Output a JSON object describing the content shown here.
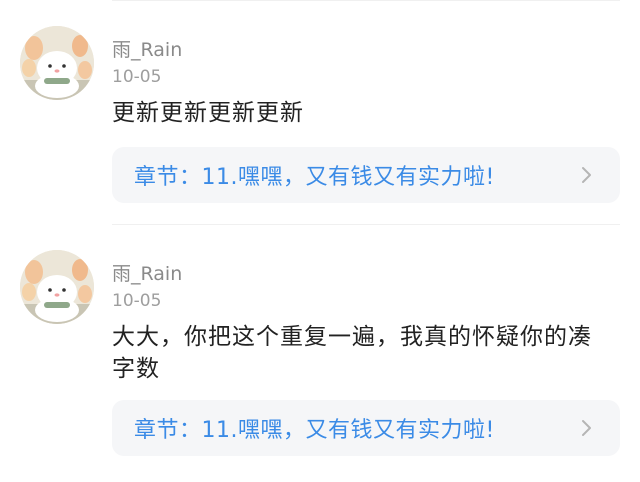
{
  "comments": [
    {
      "username": "雨_Rain",
      "date": "10-05",
      "content": "更新更新更新更新",
      "chapter_label": "章节：11.嘿嘿，又有钱又有实力啦!"
    },
    {
      "username": "雨_Rain",
      "date": "10-05",
      "content": "大大，你把这个重复一遍，我真的怀疑你的凑字数",
      "chapter_label": "章节：11.嘿嘿，又有钱又有实力啦!"
    }
  ],
  "icons": {
    "avatar": "cartoon-cat-avatar",
    "chevron": "chevron-right-icon"
  },
  "colors": {
    "accent": "#3b8be6",
    "card_bg": "#f5f6f8",
    "meta_text": "#9e9e9e"
  }
}
